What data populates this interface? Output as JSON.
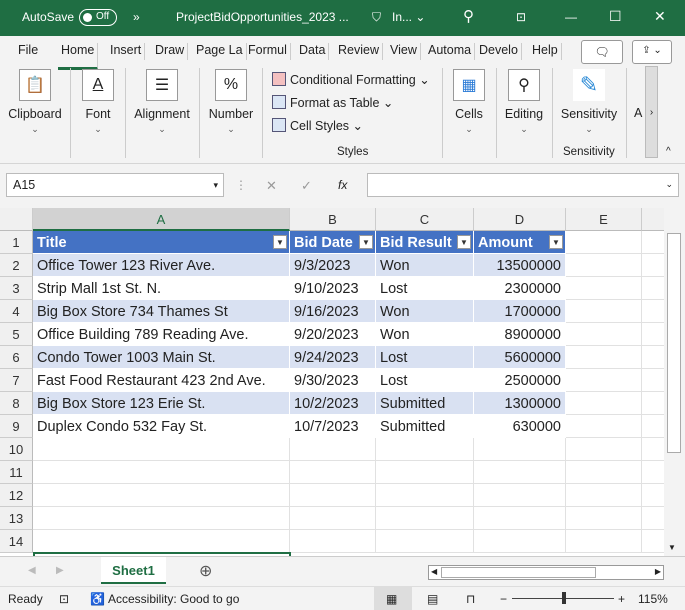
{
  "titlebar": {
    "autosave_label": "AutoSave",
    "autosave_state": "Off",
    "more": "»",
    "filename": "ProjectBidOpportunities_2023 ...",
    "sensitivity": "In... ⌄"
  },
  "tabs": [
    "File",
    "Home",
    "Insert",
    "Draw",
    "Page La",
    "Formul",
    "Data",
    "Review",
    "View",
    "Automa",
    "Develo",
    "Help"
  ],
  "ribbon": {
    "clipboard": "Clipboard",
    "font": "Font",
    "alignment": "Alignment",
    "number": "Number",
    "conditional": "Conditional Formatting ⌄",
    "format_table": "Format as Table ⌄",
    "cell_styles": "Cell Styles ⌄",
    "styles": "Styles",
    "cells": "Cells",
    "editing": "Editing",
    "sensitivity": "Sensitivity",
    "sensitivity_group": "Sensitivity",
    "addins": "A"
  },
  "formula_bar": {
    "name_box": "A15",
    "fx": "fx",
    "value": ""
  },
  "columns": [
    "A",
    "B",
    "C",
    "D",
    "E"
  ],
  "rows": [
    "1",
    "2",
    "3",
    "4",
    "5",
    "6",
    "7",
    "8",
    "9",
    "10",
    "11",
    "12",
    "13",
    "14"
  ],
  "table": {
    "headers": [
      "Title",
      "Bid Date",
      "Bid Result",
      "Amount"
    ],
    "rows": [
      [
        "Office Tower 123 River Ave.",
        "9/3/2023",
        "Won",
        "13500000"
      ],
      [
        "Strip Mall 1st St. N.",
        "9/10/2023",
        "Lost",
        "2300000"
      ],
      [
        "Big Box Store 734 Thames St",
        "9/16/2023",
        "Won",
        "1700000"
      ],
      [
        "Office Building 789 Reading Ave.",
        "9/20/2023",
        "Won",
        "8900000"
      ],
      [
        "Condo Tower 1003 Main St.",
        "9/24/2023",
        "Lost",
        "5600000"
      ],
      [
        "Fast Food Restaurant 423 2nd Ave.",
        "9/30/2023",
        "Lost",
        "2500000"
      ],
      [
        "Big Box Store 123 Erie St.",
        "10/2/2023",
        "Submitted",
        "1300000"
      ],
      [
        "Duplex Condo 532 Fay St.",
        "10/7/2023",
        "Submitted",
        "630000"
      ]
    ]
  },
  "sheet_tab": "Sheet1",
  "status": {
    "ready": "Ready",
    "accessibility": "Accessibility: Good to go",
    "zoom": "115%"
  },
  "colors": {
    "brand": "#1f6e43",
    "table_header": "#4472c4",
    "band": "#d9e1f2"
  }
}
